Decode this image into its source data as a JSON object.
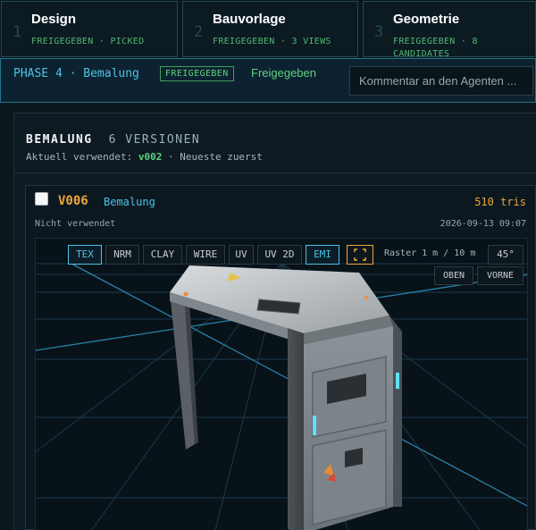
{
  "phases": [
    {
      "number": "1",
      "title": "Design",
      "status": "FREIGEGEBEN · PICKED"
    },
    {
      "number": "2",
      "title": "Bauvorlage",
      "status": "FREIGEGEBEN · 3 VIEWS"
    },
    {
      "number": "3",
      "title": "Geometrie",
      "status_line1": "FREIGEGEBEN · 8",
      "status_line2": "CANDIDATES"
    }
  ],
  "current_phase": {
    "label": "PHASE 4 · Bemalung",
    "badge": "FREIGEGEBEN",
    "status_text": "Freigegeben",
    "comment_placeholder": "Kommentar an den Agenten ..."
  },
  "panel": {
    "title": "BEMALUNG",
    "count": "6 VERSIONEN",
    "subtitle_prefix": "Aktuell verwendet: ",
    "current_version": "v002",
    "subtitle_suffix": " · Neueste zuerst"
  },
  "version": {
    "name": "V006",
    "phase": "Bemalung",
    "tris": "510 tris",
    "state": "Nicht verwendet",
    "date": "2026-09-13 09:07",
    "checked": false
  },
  "viewport": {
    "modes": [
      "TEX",
      "NRM",
      "CLAY",
      "WIRE",
      "UV",
      "UV 2D",
      "EMI"
    ],
    "active_modes": [
      "TEX",
      "EMI"
    ],
    "frame_icon": "frame-corners-icon",
    "raster": "Raster 1 m / 10 m",
    "angle": "45°",
    "views": [
      "OBEN",
      "VORNE"
    ]
  },
  "colors": {
    "accent_cyan": "#4fc2e6",
    "accent_green": "#5fd080",
    "accent_orange": "#f0a53a",
    "background": "#0b161d"
  }
}
